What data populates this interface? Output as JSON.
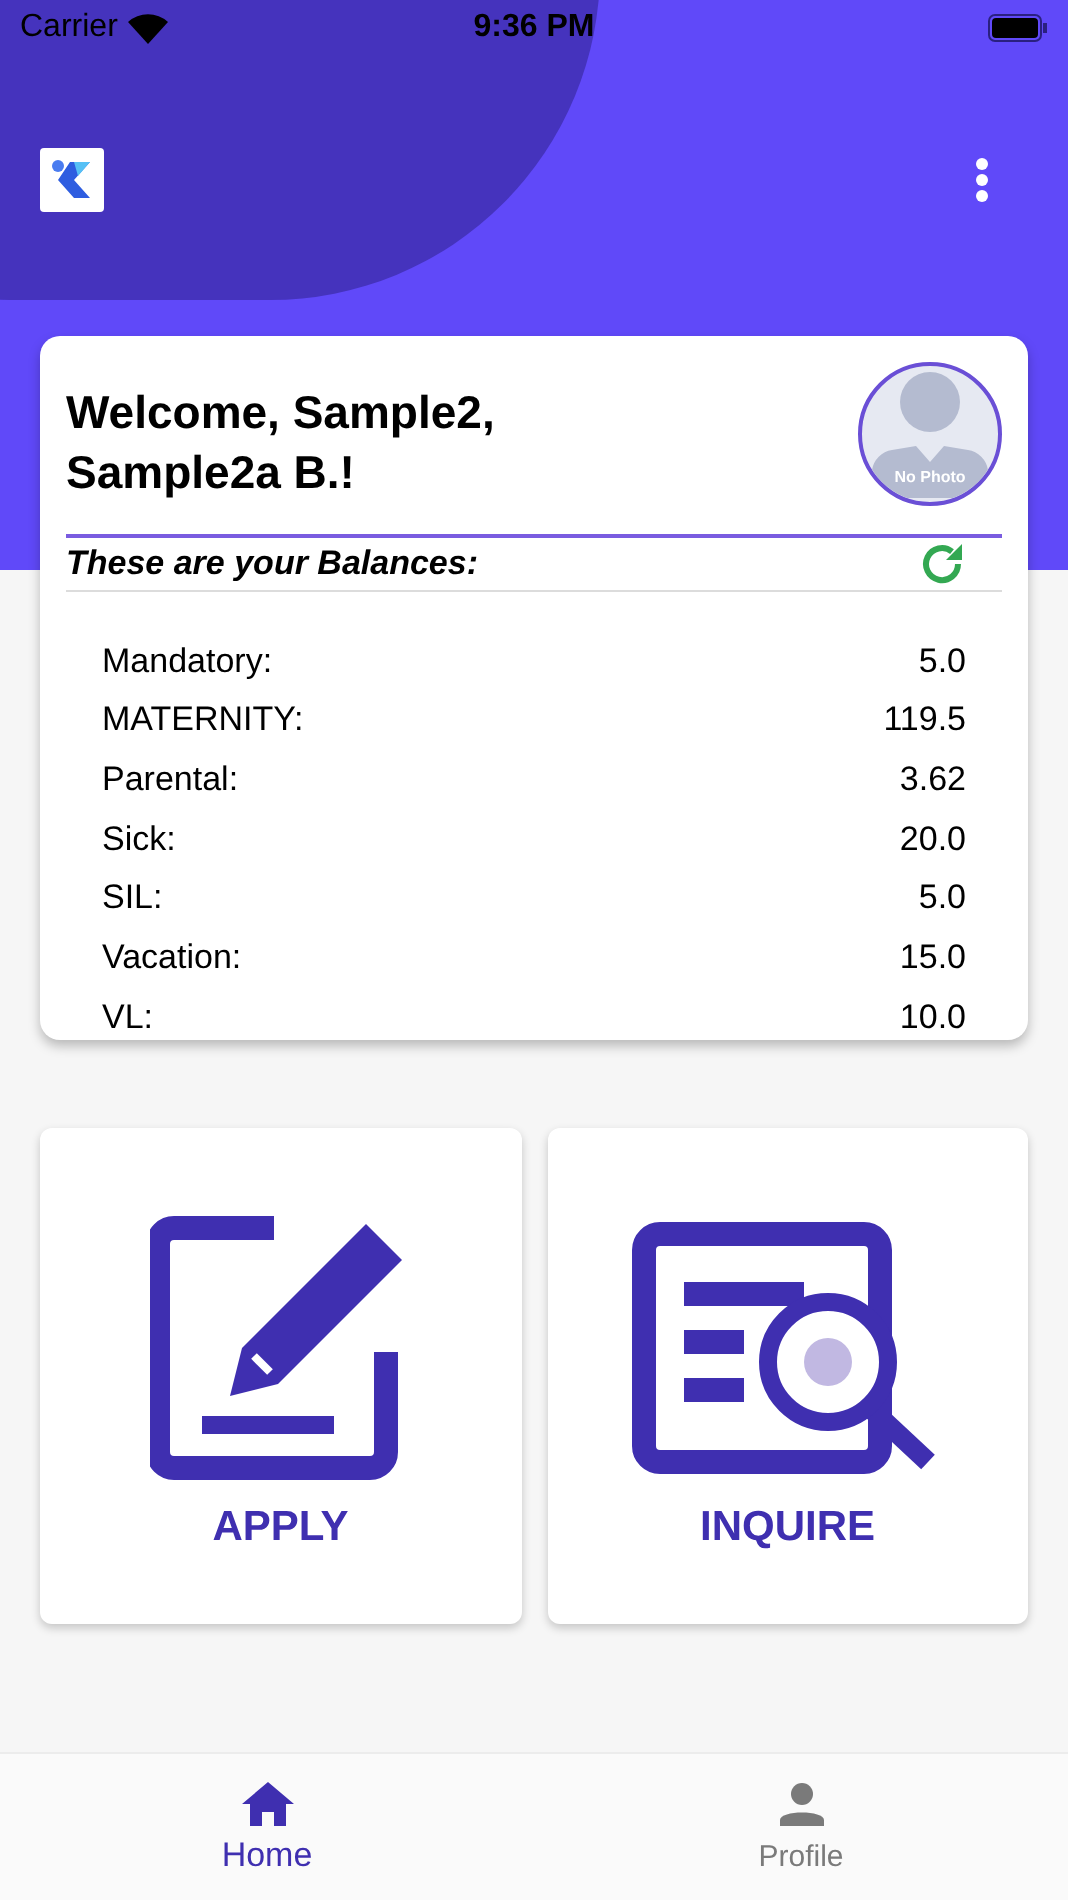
{
  "status_bar": {
    "carrier": "Carrier",
    "time": "9:36 PM"
  },
  "welcome": {
    "title": "Welcome, Sample2, Sample2a B.!",
    "avatar_caption": "No Photo"
  },
  "balances": {
    "heading": "These are your Balances:",
    "rows": [
      {
        "label": "Mandatory:",
        "value": "5.0"
      },
      {
        "label": "MATERNITY:",
        "value": "119.5"
      },
      {
        "label": "Parental:",
        "value": "3.62"
      },
      {
        "label": "Sick:",
        "value": "20.0"
      },
      {
        "label": "SIL:",
        "value": "5.0"
      },
      {
        "label": "Vacation:",
        "value": "15.0"
      },
      {
        "label": "VL:",
        "value": "10.0"
      }
    ]
  },
  "actions": [
    {
      "kind": "apply",
      "label": "APPLY"
    },
    {
      "kind": "inquire",
      "label": "INQUIRE"
    }
  ],
  "bottom_nav": [
    {
      "kind": "home",
      "label": "Home",
      "selected": true
    },
    {
      "kind": "profile",
      "label": "Profile",
      "selected": false
    }
  ]
}
